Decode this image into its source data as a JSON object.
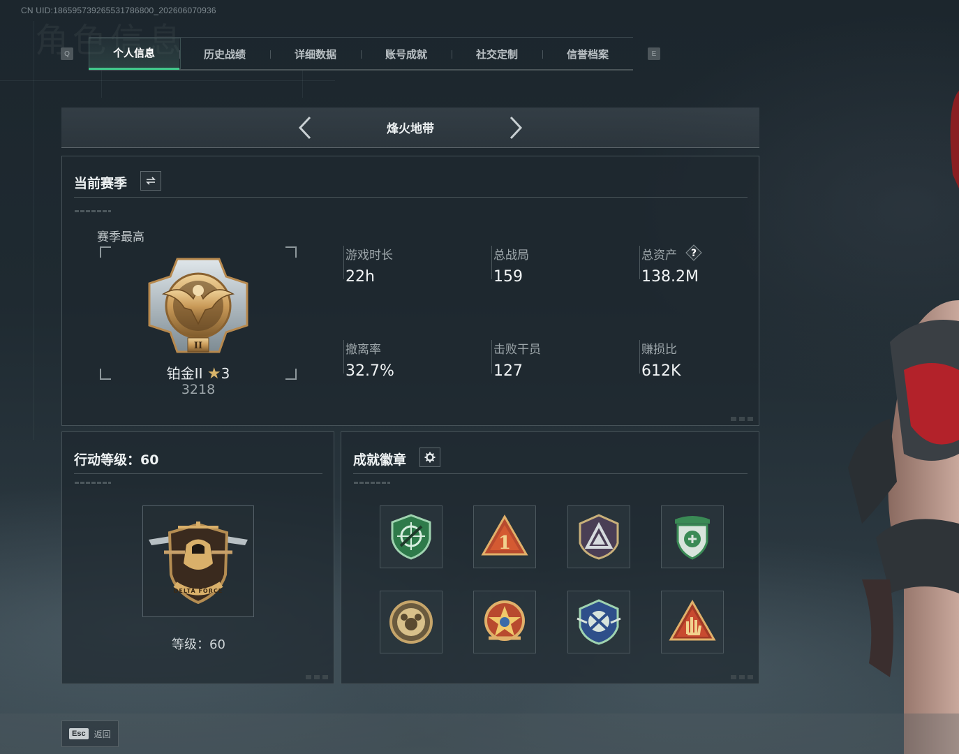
{
  "uid_text": "CN UID:186595739265531786800_202606070936",
  "watermark_text": "角色信息",
  "tabs": {
    "key_left": "Q",
    "key_right": "E",
    "items": [
      "个人信息",
      "历史战绩",
      "详细数据",
      "账号成就",
      "社交定制",
      "信誉档案"
    ],
    "active_index": 0
  },
  "mode": {
    "title": "烽火地带"
  },
  "season": {
    "title": "当前赛季",
    "best_label": "赛季最高",
    "rank_name": "铂金II",
    "rank_stars": "3",
    "rank_points": "3218",
    "stats": [
      {
        "label": "游戏时长",
        "value": "22h"
      },
      {
        "label": "总战局",
        "value": "159"
      },
      {
        "label": "总资产",
        "value": "138.2M",
        "help": "?"
      },
      {
        "label": "撤离率",
        "value": "32.7%"
      },
      {
        "label": "击败干员",
        "value": "127"
      },
      {
        "label": "赚损比",
        "value": "612K"
      }
    ]
  },
  "level": {
    "title": "行动等级：60",
    "level_text": "等级：60",
    "emblem_text": "DELTA FORCE"
  },
  "badges": {
    "title": "成就徽章",
    "items": [
      "green-shield-crosshair-badge",
      "red-triangle-number-one-badge",
      "purple-shield-triangle-badge",
      "green-shield-emblem-badge",
      "bronze-round-badge",
      "star-ribbon-badge",
      "blue-shield-wings-badge",
      "red-triangle-hand-badge"
    ]
  },
  "footer": {
    "esc_key": "Esc",
    "back_label": "返回"
  },
  "colors": {
    "accent": "#39d08a",
    "text": "#eef2f3",
    "muted": "#9ea7ab"
  }
}
